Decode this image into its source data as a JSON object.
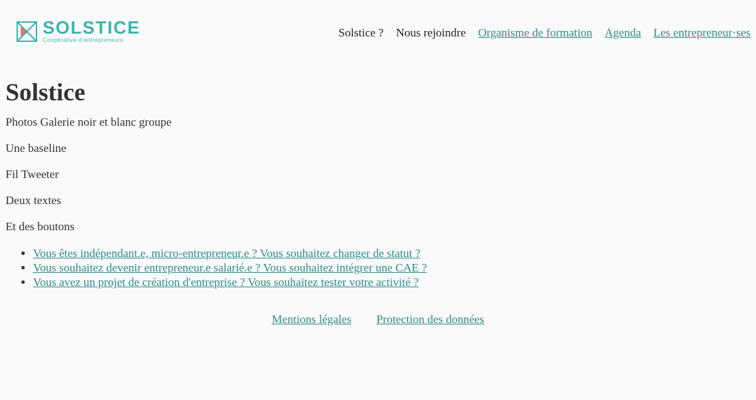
{
  "header": {
    "logo": {
      "name": "SOLSTICE",
      "tagline": "Coopérative d'entrepreneurs",
      "accent_color": "#3bb4ad",
      "mark_accent": "#e05a5a"
    },
    "nav": [
      {
        "label": "Solstice ?",
        "is_link": false
      },
      {
        "label": "Nous rejoindre",
        "is_link": false
      },
      {
        "label": "Organisme de formation",
        "is_link": true
      },
      {
        "label": "Agenda",
        "is_link": true
      },
      {
        "label": "Les entrepreneur·ses",
        "is_link": true
      }
    ]
  },
  "main": {
    "title": "Solstice",
    "paragraphs": [
      "Photos Galerie noir et blanc groupe",
      "Une baseline",
      "Fil Tweeter",
      "Deux textes",
      "Et des boutons"
    ],
    "cta_links": [
      "Vous êtes indépendant.e, micro-entrepreneur.e ? Vous souhaitez changer de statut ?",
      "Vous souhaitez devenir entrepreneur.e salarié.e ? Vous souhaitez intégrer une CAE ?",
      "Vous avez un projet de création d'entreprise ? Vous souhaitez tester votre activité ?"
    ]
  },
  "footer": {
    "links": [
      "Mentions légales",
      "Protection des données"
    ]
  },
  "colors": {
    "background": "#fafafa",
    "text": "#333333",
    "link": "#2f8a8a"
  }
}
